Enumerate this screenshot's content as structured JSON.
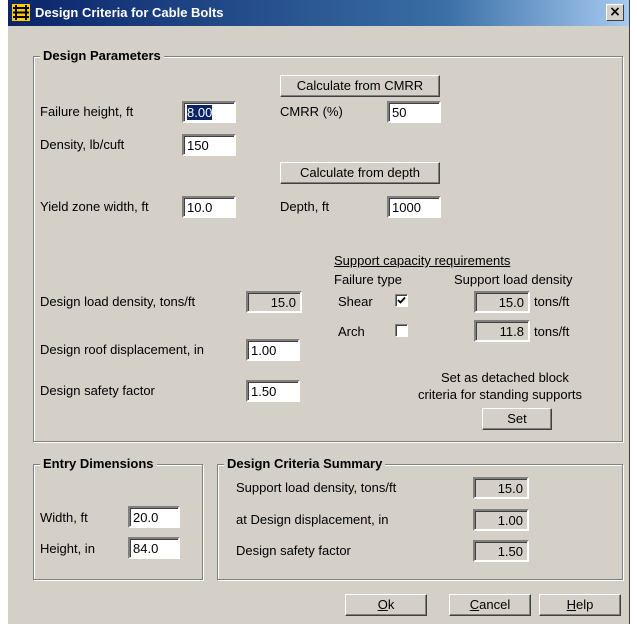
{
  "window": {
    "title": "Design Criteria for Cable Bolts",
    "close_glyph": "×"
  },
  "design_params": {
    "legend": "Design Parameters",
    "calc_cmrr_label": "Calculate from CMRR",
    "failure_height_label": "Failure height, ft",
    "failure_height_value": "8.00",
    "cmrr_label": "CMRR (%)",
    "cmrr_value": "50",
    "density_label": "Density, lb/cuft",
    "density_value": "150",
    "calc_depth_label": "Calculate from depth",
    "yield_zone_label": "Yield zone width, ft",
    "yield_zone_value": "10.0",
    "depth_label": "Depth, ft",
    "depth_value": "1000",
    "support_req_label": "Support capacity requirements",
    "failure_type_label": "Failure type",
    "support_load_density_label": "Support load density",
    "design_load_density_label": "Design load density, tons/ft",
    "design_load_density_value": "15.0",
    "shear_label": "Shear",
    "shear_checked": true,
    "shear_value": "15.0",
    "shear_unit": "tons/ft",
    "arch_label": "Arch",
    "arch_checked": false,
    "arch_value": "11.8",
    "arch_unit": "tons/ft",
    "roof_disp_label": "Design roof displacement, in",
    "roof_disp_value": "1.00",
    "safety_factor_label": "Design safety factor",
    "safety_factor_value": "1.50",
    "set_detached_line1": "Set as detached block",
    "set_detached_line2": "criteria for standing supports",
    "set_button": "Set"
  },
  "entry_dims": {
    "legend": "Entry Dimensions",
    "width_label": "Width, ft",
    "width_value": "20.0",
    "height_label": "Height, in",
    "height_value": "84.0"
  },
  "summary": {
    "legend": "Design Criteria Summary",
    "load_density_label": "Support load density, tons/ft",
    "load_density_value": "15.0",
    "displacement_label": "at Design displacement, in",
    "displacement_value": "1.00",
    "safety_factor_label": "Design safety factor",
    "safety_factor_value": "1.50"
  },
  "buttons": {
    "ok_mnemonic": "O",
    "ok_rest": "k",
    "cancel_mnemonic": "C",
    "cancel_rest": "ancel",
    "help_mnemonic": "H",
    "help_rest": "elp"
  }
}
